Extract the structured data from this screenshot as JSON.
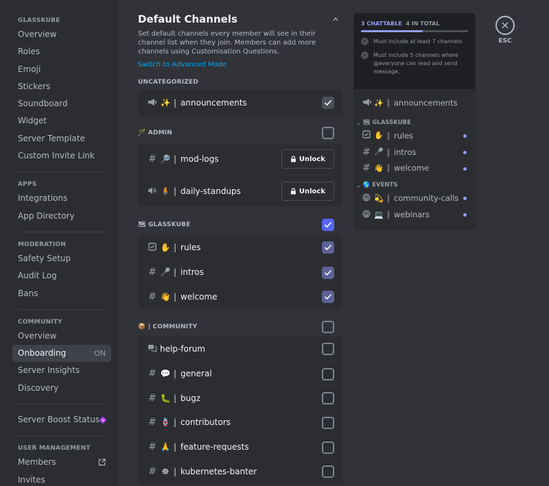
{
  "sidebar": {
    "sections": [
      {
        "header": "GLASSKUBE",
        "items": [
          "Overview",
          "Roles",
          "Emoji",
          "Stickers",
          "Soundboard",
          "Widget",
          "Server Template",
          "Custom Invite Link"
        ]
      },
      {
        "header": "APPS",
        "items": [
          "Integrations",
          "App Directory"
        ]
      },
      {
        "header": "MODERATION",
        "items": [
          "Safety Setup",
          "Audit Log",
          "Bans"
        ]
      },
      {
        "header": "COMMUNITY",
        "items": [
          "Overview",
          "Onboarding",
          "Server Insights",
          "Discovery"
        ]
      },
      {
        "header": "",
        "items": [
          "Server Boost Status"
        ]
      },
      {
        "header": "USER MANAGEMENT",
        "items": [
          "Members",
          "Invites"
        ]
      }
    ],
    "active_item": "Onboarding",
    "onboarding_status": "ON"
  },
  "main": {
    "title": "Default Channels",
    "description": "Set default channels every member will see in their channel list when they join. Members can add more channels using Customisation Questions.",
    "advanced_link": "Switch to Advanced Mode",
    "uncategorized_label": "UNCATEGORIZED",
    "admin_label": "🪄 ADMIN",
    "glasskube_label": "🗺 GLASSKUBE",
    "community_label": "📦 | COMMUNITY",
    "unlock_label": "Unlock",
    "uncategorized": [
      {
        "icon": "megaphone",
        "emoji": "✨",
        "name": "announcements",
        "checked": true
      }
    ],
    "admin": [
      {
        "icon": "#",
        "emoji": "🔎",
        "name": "mod-logs"
      },
      {
        "icon": "voice",
        "emoji": "🧍",
        "name": "daily-standups"
      }
    ],
    "glasskube": [
      {
        "icon": "rules",
        "emoji": "✋",
        "name": "rules",
        "checked": true
      },
      {
        "icon": "#",
        "emoji": "🎤",
        "name": "intros",
        "checked": true
      },
      {
        "icon": "#",
        "emoji": "👋",
        "name": "welcome",
        "checked": true
      }
    ],
    "community": [
      {
        "icon": "forum",
        "emoji": "",
        "name": "help-forum",
        "checked": false
      },
      {
        "icon": "#",
        "emoji": "💬",
        "name": "general",
        "checked": false
      },
      {
        "icon": "#",
        "emoji": "🐛",
        "name": "bugz",
        "checked": false
      },
      {
        "icon": "#",
        "emoji": "🪢",
        "name": "contributors",
        "checked": false
      },
      {
        "icon": "#",
        "emoji": "🙏",
        "name": "feature-requests",
        "checked": false
      },
      {
        "icon": "#",
        "emoji": "☸",
        "name": "kubernetes-banter",
        "checked": false
      }
    ]
  },
  "panel": {
    "chattable": "3 CHATTABLE",
    "total": "4 IN TOTAL",
    "progress": 0.58,
    "requirements": [
      "Must include at least 7 channels",
      "Must include 5 channels where @everyone can read and send message."
    ],
    "top_channel": {
      "icon": "megaphone",
      "emoji": "✨",
      "name": "announcements"
    },
    "categories": [
      {
        "name": "🗺 GLASSKUBE",
        "channels": [
          {
            "icon": "rules",
            "emoji": "✋",
            "name": "rules",
            "dot": true
          },
          {
            "icon": "#",
            "emoji": "🎤",
            "name": "intros",
            "dot": true
          },
          {
            "icon": "#",
            "emoji": "👋",
            "name": "welcome",
            "dot": true
          }
        ]
      },
      {
        "name": "🌎 EVENTS",
        "channels": [
          {
            "icon": "stage",
            "emoji": "💫",
            "name": "community-calls",
            "dot": true
          },
          {
            "icon": "stage",
            "emoji": "💻",
            "name": "webinars",
            "dot": true
          }
        ]
      }
    ]
  },
  "esc": {
    "label": "ESC"
  },
  "colors": {
    "accent": "#5865f2",
    "progress": "#949cf7",
    "link": "#00a8fc"
  }
}
